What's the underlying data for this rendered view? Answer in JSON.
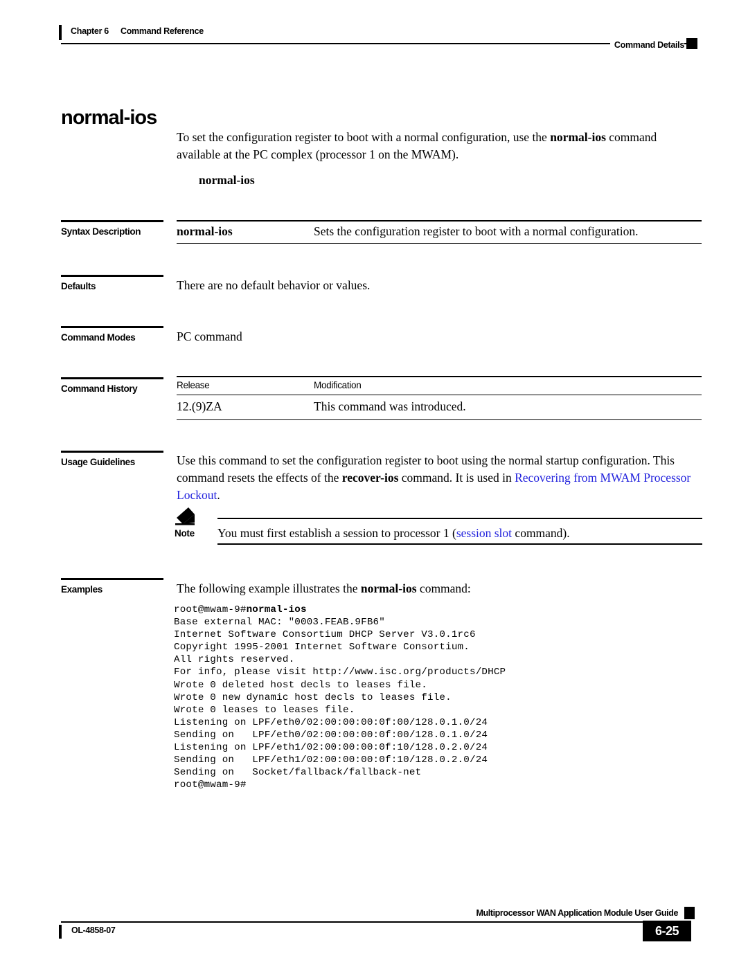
{
  "header": {
    "chapter_number": "Chapter 6",
    "chapter_title": "Command Reference",
    "section_marker": "Command Details"
  },
  "command": {
    "title": "normal-ios",
    "intro_part1": "To set the configuration register to boot with a normal configuration, use the ",
    "intro_bold": "normal-ios",
    "intro_part2": " command available at the PC complex (processor 1 on the MWAM).",
    "syntax_line": "normal-ios"
  },
  "sections": {
    "syntax_description": {
      "label": "Syntax Description",
      "rows": [
        {
          "term": "normal-ios",
          "description": "Sets the configuration register to boot with a normal configuration."
        }
      ]
    },
    "defaults": {
      "label": "Defaults",
      "text": "There are no default behavior or values."
    },
    "command_modes": {
      "label": "Command Modes",
      "text": "PC command"
    },
    "command_history": {
      "label": "Command History",
      "columns": [
        "Release",
        "Modification"
      ],
      "rows": [
        {
          "release": "12.(9)ZA",
          "modification": "This command was introduced."
        }
      ]
    },
    "usage_guidelines": {
      "label": "Usage Guidelines",
      "text_part1": "Use this command to set the configuration register to boot using the normal startup configuration. This command resets the effects of the ",
      "text_bold": "recover-ios",
      "text_part2": " command. It is used in ",
      "link_text": "Recovering from MWAM Processor Lockout",
      "text_part3": "."
    },
    "note": {
      "label": "Note",
      "text_part1": "You must first establish a session to processor 1 (",
      "link_text": "session slot",
      "text_part2": " command)."
    },
    "examples": {
      "label": "Examples",
      "intro_part1": "The following example illustrates the ",
      "intro_bold": "normal-ios",
      "intro_part2": " command:",
      "code_prompt": "root@mwam-9#",
      "code_command": "normal-ios",
      "code_output": "Base external MAC: \"0003.FEAB.9FB6\"\nInternet Software Consortium DHCP Server V3.0.1rc6\nCopyright 1995-2001 Internet Software Consortium.\nAll rights reserved.\nFor info, please visit http://www.isc.org/products/DHCP\nWrote 0 deleted host decls to leases file.\nWrote 0 new dynamic host decls to leases file.\nWrote 0 leases to leases file.\nListening on LPF/eth0/02:00:00:00:0f:00/128.0.1.0/24\nSending on   LPF/eth0/02:00:00:00:0f:00/128.0.1.0/24\nListening on LPF/eth1/02:00:00:00:0f:10/128.0.2.0/24\nSending on   LPF/eth1/02:00:00:00:0f:10/128.0.2.0/24\nSending on   Socket/fallback/fallback-net\nroot@mwam-9#"
    }
  },
  "footer": {
    "guide_title": "Multiprocessor WAN Application Module User Guide",
    "doc_number": "OL-4858-07",
    "page_number": "6-25"
  },
  "colors": {
    "link": "#2222dd",
    "text": "#000000",
    "page_background": "#ffffff"
  }
}
